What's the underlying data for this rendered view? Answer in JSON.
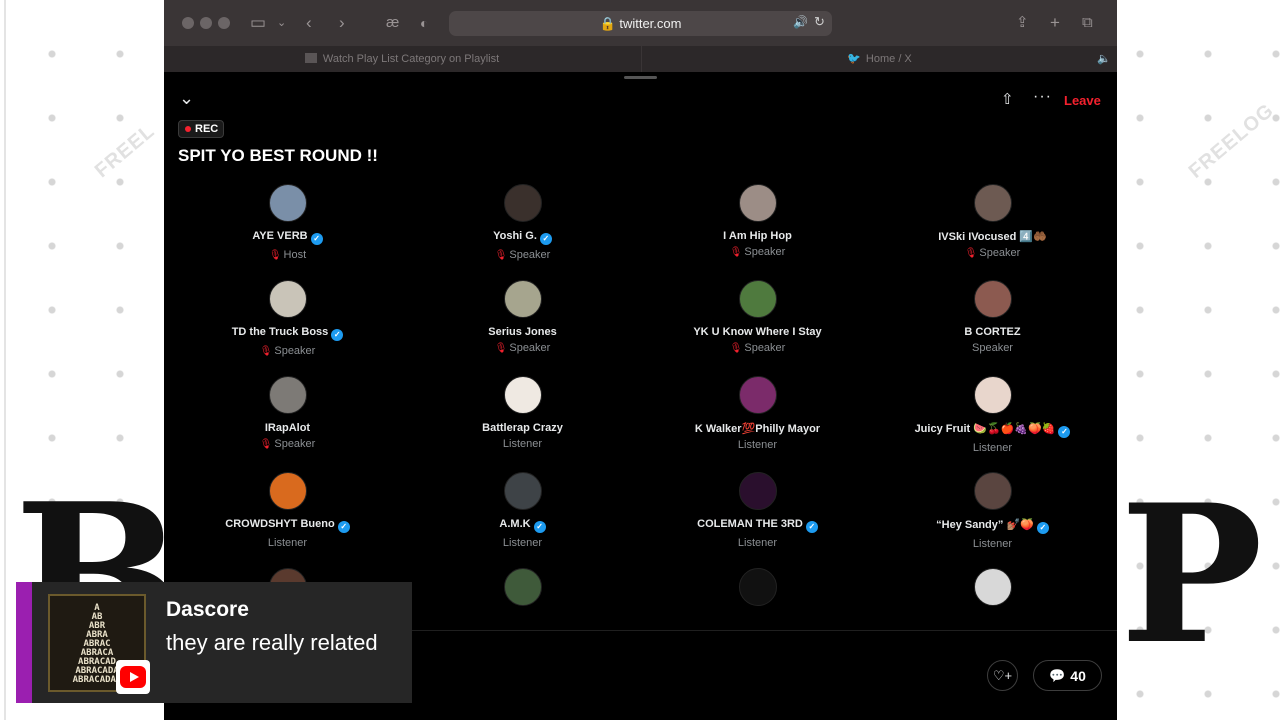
{
  "browser": {
    "url": "twitter.com",
    "tabs": [
      {
        "label": "Watch Play List Category on Playlist"
      },
      {
        "label": "Home / X"
      }
    ]
  },
  "space": {
    "rec_label": "REC",
    "title": "SPIT YO BEST ROUND !!",
    "leave_label": "Leave",
    "comment_count": "40",
    "participants": [
      {
        "name": "AYE VERB",
        "verified": true,
        "role": "Host",
        "speaking": true,
        "avatar_color": "#7a8fa8"
      },
      {
        "name": "Yoshi G.",
        "verified": true,
        "role": "Speaker",
        "speaking": true,
        "avatar_color": "#3a302c"
      },
      {
        "name": "I Am Hip Hop",
        "verified": false,
        "role": "Speaker",
        "speaking": true,
        "avatar_color": "#9c8d86"
      },
      {
        "name": "IVSki IVocused 4️⃣🤲🏾",
        "verified": false,
        "role": "Speaker",
        "speaking": true,
        "avatar_color": "#6d5a52"
      },
      {
        "name": "TD the Truck Boss",
        "verified": true,
        "role": "Speaker",
        "speaking": true,
        "avatar_color": "#c9c4b8"
      },
      {
        "name": "Serius Jones",
        "verified": false,
        "role": "Speaker",
        "speaking": true,
        "avatar_color": "#a6a58e"
      },
      {
        "name": "YK U Know Where I Stay",
        "verified": false,
        "role": "Speaker",
        "speaking": true,
        "avatar_color": "#4f7a3e"
      },
      {
        "name": "B CORTEZ",
        "verified": false,
        "role": "Speaker",
        "speaking": false,
        "avatar_color": "#8c5a50"
      },
      {
        "name": "IRapAlot",
        "verified": false,
        "role": "Speaker",
        "speaking": true,
        "avatar_color": "#7d7a76"
      },
      {
        "name": "Battlerap Crazy",
        "verified": false,
        "role": "Listener",
        "speaking": false,
        "avatar_color": "#efe9e2"
      },
      {
        "name": "K Walker💯Philly Mayor",
        "verified": false,
        "role": "Listener",
        "speaking": false,
        "avatar_color": "#7b2b6a"
      },
      {
        "name": "Juicy Fruit 🍉🍒🍎🍇🍑🍓",
        "verified": true,
        "role": "Listener",
        "speaking": false,
        "avatar_color": "#e8d6cc"
      },
      {
        "name": "CROWDSHYT Bueno",
        "verified": true,
        "role": "Listener",
        "speaking": false,
        "avatar_color": "#d96a1e"
      },
      {
        "name": "A.M.K",
        "verified": true,
        "role": "Listener",
        "speaking": false,
        "avatar_color": "#3e4347"
      },
      {
        "name": "COLEMAN THE 3RD",
        "verified": true,
        "role": "Listener",
        "speaking": false,
        "avatar_color": "#2a0f2d"
      },
      {
        "name": "“Hey Sandy” 💅🏽🍑",
        "verified": true,
        "role": "Listener",
        "speaking": false,
        "avatar_color": "#5a4540"
      }
    ],
    "partial_row": [
      {
        "avatar_color": "#5a3a2e"
      },
      {
        "avatar_color": "#3f5a3a"
      },
      {
        "avatar_color": "#111111"
      },
      {
        "avatar_color": "#d8d8d8"
      }
    ]
  },
  "chat_overlay": {
    "author": "Dascore",
    "message": "they are really related",
    "art_text": [
      "A",
      "AB",
      "ABR",
      "ABRA",
      "ABRAC",
      "ABRACA",
      "ABRACAD",
      "ABRACADA",
      "ABRACADAB"
    ]
  },
  "colors": {
    "leave": "#f4212e",
    "verified": "#1d9bf0",
    "chat_accent": "#9b1fb0"
  }
}
